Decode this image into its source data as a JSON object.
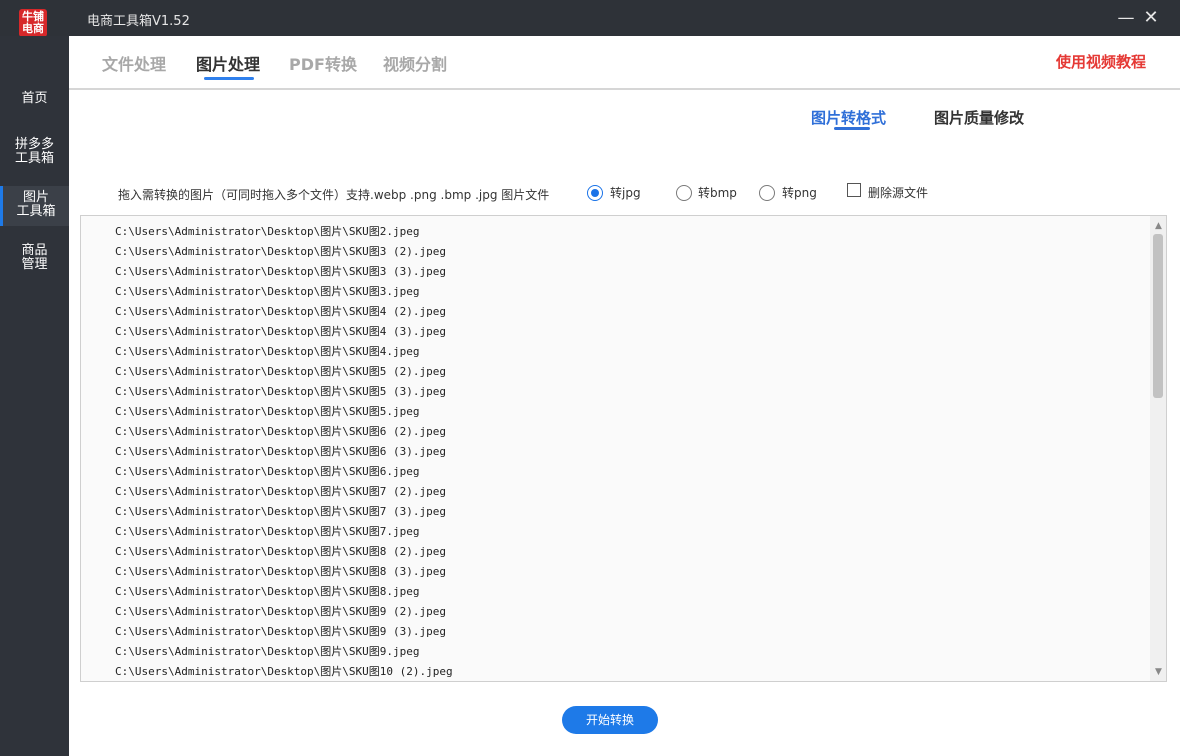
{
  "titlebar": {
    "logo_text": "牛铺电商",
    "title": "电商工具箱V1.52",
    "minimize_symbol": "—",
    "close_symbol": "✕"
  },
  "sidebar": {
    "items": [
      {
        "line1": "首页",
        "line2": ""
      },
      {
        "line1": "拼多多",
        "line2": "工具箱"
      },
      {
        "line1": "图片",
        "line2": "工具箱"
      },
      {
        "line1": "商品",
        "line2": "管理"
      }
    ]
  },
  "main_tabs": [
    "文件处理",
    "图片处理",
    "PDF转换",
    "视频分割"
  ],
  "tutorial_link": "使用视频教程",
  "sub_tabs": [
    "图片转格式",
    "图片质量修改"
  ],
  "hint": "拖入需转换的图片（可同时拖入多个文件）支持.webp .png .bmp .jpg 图片文件",
  "options": {
    "jpg": "转jpg",
    "bmp": "转bmp",
    "png": "转png",
    "delete_source": "删除源文件",
    "selected": "jpg"
  },
  "files": [
    "C:\\Users\\Administrator\\Desktop\\图片\\SKU图2.jpeg",
    "C:\\Users\\Administrator\\Desktop\\图片\\SKU图3 (2).jpeg",
    "C:\\Users\\Administrator\\Desktop\\图片\\SKU图3 (3).jpeg",
    "C:\\Users\\Administrator\\Desktop\\图片\\SKU图3.jpeg",
    "C:\\Users\\Administrator\\Desktop\\图片\\SKU图4 (2).jpeg",
    "C:\\Users\\Administrator\\Desktop\\图片\\SKU图4 (3).jpeg",
    "C:\\Users\\Administrator\\Desktop\\图片\\SKU图4.jpeg",
    "C:\\Users\\Administrator\\Desktop\\图片\\SKU图5 (2).jpeg",
    "C:\\Users\\Administrator\\Desktop\\图片\\SKU图5 (3).jpeg",
    "C:\\Users\\Administrator\\Desktop\\图片\\SKU图5.jpeg",
    "C:\\Users\\Administrator\\Desktop\\图片\\SKU图6 (2).jpeg",
    "C:\\Users\\Administrator\\Desktop\\图片\\SKU图6 (3).jpeg",
    "C:\\Users\\Administrator\\Desktop\\图片\\SKU图6.jpeg",
    "C:\\Users\\Administrator\\Desktop\\图片\\SKU图7 (2).jpeg",
    "C:\\Users\\Administrator\\Desktop\\图片\\SKU图7 (3).jpeg",
    "C:\\Users\\Administrator\\Desktop\\图片\\SKU图7.jpeg",
    "C:\\Users\\Administrator\\Desktop\\图片\\SKU图8 (2).jpeg",
    "C:\\Users\\Administrator\\Desktop\\图片\\SKU图8 (3).jpeg",
    "C:\\Users\\Administrator\\Desktop\\图片\\SKU图8.jpeg",
    "C:\\Users\\Administrator\\Desktop\\图片\\SKU图9 (2).jpeg",
    "C:\\Users\\Administrator\\Desktop\\图片\\SKU图9 (3).jpeg",
    "C:\\Users\\Administrator\\Desktop\\图片\\SKU图9.jpeg",
    "C:\\Users\\Administrator\\Desktop\\图片\\SKU图10 (2).jpeg"
  ],
  "start_button": "开始转换",
  "colors": {
    "accent": "#1e7ae8",
    "tutorial_red": "#e53935",
    "titlebar": "#2e3238",
    "sidebar": "#2f333a"
  }
}
